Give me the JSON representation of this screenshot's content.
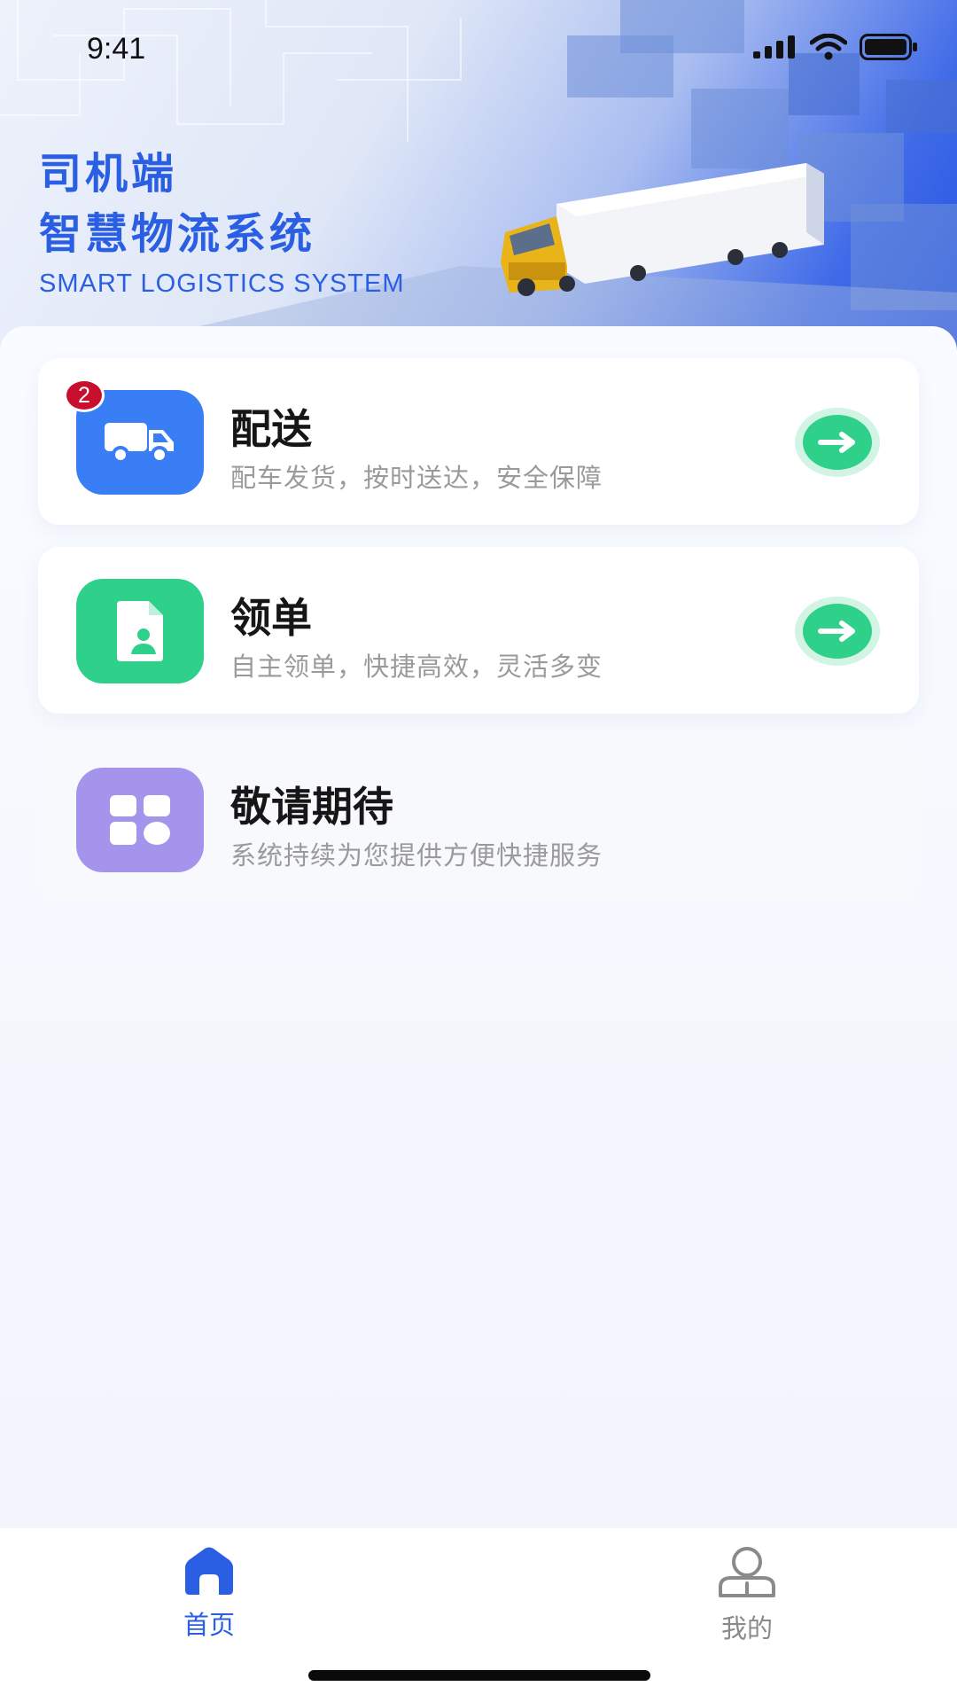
{
  "status_bar": {
    "time": "9:41"
  },
  "hero": {
    "title_line1": "司机端",
    "title_line2": "智慧物流系统",
    "subtitle": "SMART LOGISTICS SYSTEM"
  },
  "cards": [
    {
      "title": "配送",
      "desc": "配车发货，按时送达，安全保障",
      "badge": "2",
      "icon": "truck-icon",
      "color": "#3a7ef6"
    },
    {
      "title": "领单",
      "desc": "自主领单，快捷高效，灵活多变",
      "icon": "order-document-icon",
      "color": "#2fd08a"
    },
    {
      "title": "敬请期待",
      "desc": "系统持续为您提供方便快捷服务",
      "icon": "apps-grid-icon",
      "color": "#a594ec"
    }
  ],
  "tabs": [
    {
      "label": "首页",
      "icon": "home-icon",
      "active": true
    },
    {
      "label": "我的",
      "icon": "user-icon",
      "active": false
    }
  ],
  "colors": {
    "accent": "#2a5fe3",
    "go": "#2fd08a",
    "badge": "#c8102e"
  }
}
